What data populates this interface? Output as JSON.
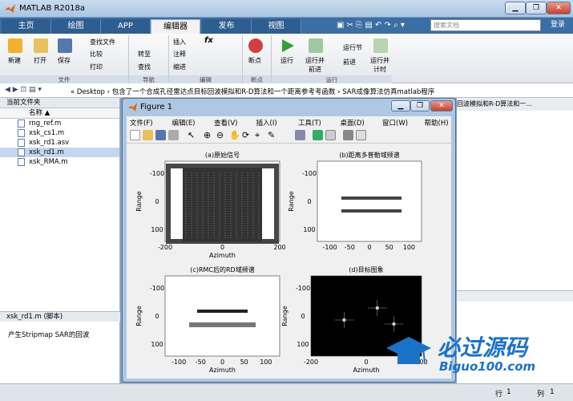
{
  "window": {
    "title": "MATLAB R2018a",
    "minimize": "▁",
    "restore": "❐",
    "close": "✕"
  },
  "tabs": [
    {
      "label": "主页"
    },
    {
      "label": "绘图"
    },
    {
      "label": "APP"
    },
    {
      "label": "编辑器"
    },
    {
      "label": "发布"
    },
    {
      "label": "视图"
    }
  ],
  "search_placeholder": "搜索文档",
  "login": "登录",
  "ribbon": {
    "new": "新建",
    "open": "打开",
    "save": "保存",
    "find_file": "查找文件",
    "compare": "比较",
    "print": "打印",
    "insert": "插入",
    "fx": "fx",
    "comment": "注释",
    "indent": "缩进",
    "goto": "转至",
    "find": "查找",
    "breakpoint": "断点",
    "run": "运行",
    "run_advance": "运行并\n前进",
    "run_section": "运行节",
    "advance": "前进",
    "run_time": "运行并\n计时",
    "groups": [
      "文件",
      "导航",
      "编辑",
      "断点",
      "运行"
    ]
  },
  "address": {
    "path": "« Desktop › 包含了一个合成孔径雷达点目标回波模拟和R-D算法和一个距离参考考函数 › SAR成像算法仿真matlab程序"
  },
  "file_browser": {
    "title": "当前文件夹",
    "col": "名称 ▲",
    "files": [
      "rng_ref.m",
      "xsk_cs1.m",
      "xsk_rd1.asv",
      "xsk_rd1.m",
      "xsk_RMA.m"
    ],
    "selected": 3
  },
  "details": {
    "title": "xsk_rd1.m  (脚本)",
    "desc": "产生Stripmap SAR的回波"
  },
  "right_text": "回波模拟和R-D算法和一...",
  "status": {
    "row": "行",
    "row_val": "1",
    "col": "列",
    "col_val": "1"
  },
  "figure": {
    "title": "Figure 1",
    "menus": [
      "文件(F)",
      "编辑(E)",
      "查看(V)",
      "插入(I)",
      "工具(T)",
      "桌面(D)",
      "窗口(W)",
      "帮助(H)"
    ],
    "plots": [
      {
        "title": "(a)原始信号",
        "xlabel": "Azimuth",
        "ylabel": "Range",
        "xticks": [
          "-200",
          "0",
          "200"
        ],
        "yticks": [
          "-100",
          "0",
          "100"
        ]
      },
      {
        "title": "(b)距离多普勒域频谱",
        "xlabel": "",
        "ylabel": "Range",
        "xticks": [
          "-100",
          "-50",
          "0",
          "50",
          "100"
        ],
        "yticks": [
          "-100",
          "0",
          "100"
        ]
      },
      {
        "title": "(c)RMC后的RD域频谱",
        "xlabel": "Azimuth",
        "ylabel": "Range",
        "xticks": [
          "-100",
          "-50",
          "0",
          "50",
          "100"
        ],
        "yticks": [
          "-100",
          "0",
          "100"
        ]
      },
      {
        "title": "(d)目标图象",
        "xlabel": "Azimuth",
        "ylabel": "Range",
        "xticks": [
          "-200",
          "0",
          "200"
        ],
        "yticks": [
          "-100",
          "0",
          "100"
        ]
      }
    ]
  },
  "watermark": {
    "cn": "必过源码",
    "url": "Biguo100.com"
  }
}
